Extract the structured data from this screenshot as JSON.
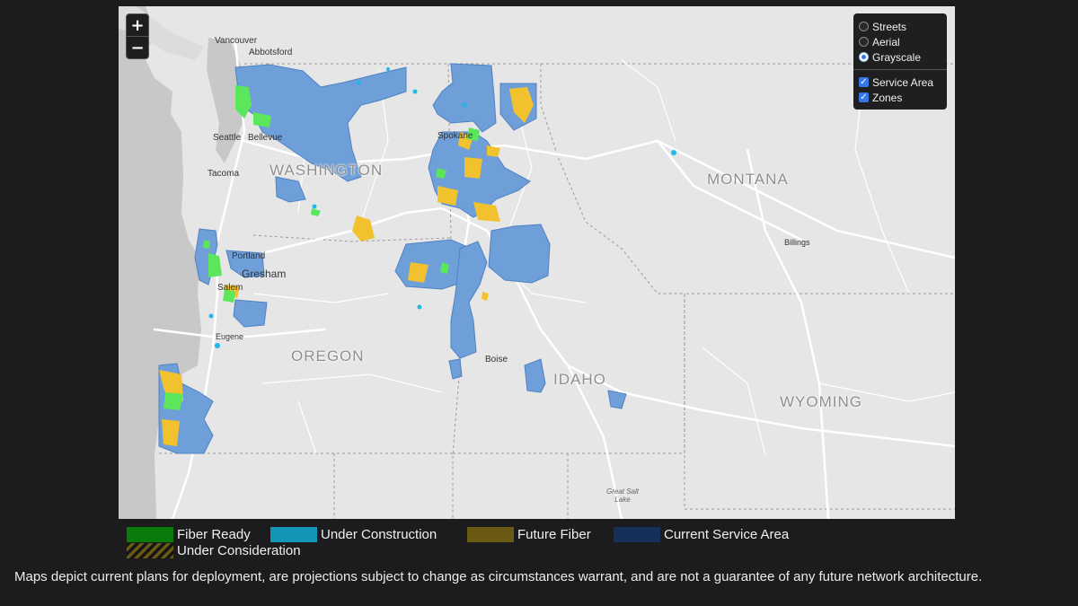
{
  "map": {
    "controls": {
      "zoom_in": "+",
      "zoom_out": "−"
    },
    "layers": {
      "base": [
        {
          "label": "Streets",
          "selected": false
        },
        {
          "label": "Aerial",
          "selected": false
        },
        {
          "label": "Grayscale",
          "selected": true
        }
      ],
      "overlays": [
        {
          "label": "Service Area",
          "checked": true
        },
        {
          "label": "Zones",
          "checked": true
        }
      ]
    },
    "labels": {
      "vancouver": "Vancouver",
      "abbotsford": "Abbotsford",
      "seattle": "Seattle",
      "bellevue": "Bellevue",
      "tacoma": "Tacoma",
      "spokane": "Spokane",
      "portland": "Portland",
      "gresham": "Gresham",
      "salem": "Salem",
      "eugene": "Eugene",
      "boise": "Boise",
      "billings": "Billings",
      "great_salt_lake": "Great Salt Lake",
      "washington": "WASHINGTON",
      "oregon": "OREGON",
      "idaho": "IDAHO",
      "montana": "MONTANA",
      "wyoming": "WYOMING"
    },
    "colors": {
      "land": "#e6e6e6",
      "water": "#c8c8c8",
      "service_area": "#6f9fd8",
      "fiber_ready": "#5ce65c",
      "under_construction": "#1eb8ea",
      "future_fiber": "#f2c12e"
    }
  },
  "legend": {
    "items": [
      {
        "label": "Fiber Ready",
        "color": "#0a7a0a"
      },
      {
        "label": "Under Construction",
        "color": "#1496b8"
      },
      {
        "label": "Future Fiber",
        "color": "#6b5a14"
      },
      {
        "label": "Current Service Area",
        "color": "#17305a"
      },
      {
        "label": "Under Consideration",
        "color": "hatch"
      }
    ]
  },
  "disclaimer": "Maps depict current plans for deployment, are projections subject to change as circumstances warrant, and are not a guarantee of any future network architecture."
}
